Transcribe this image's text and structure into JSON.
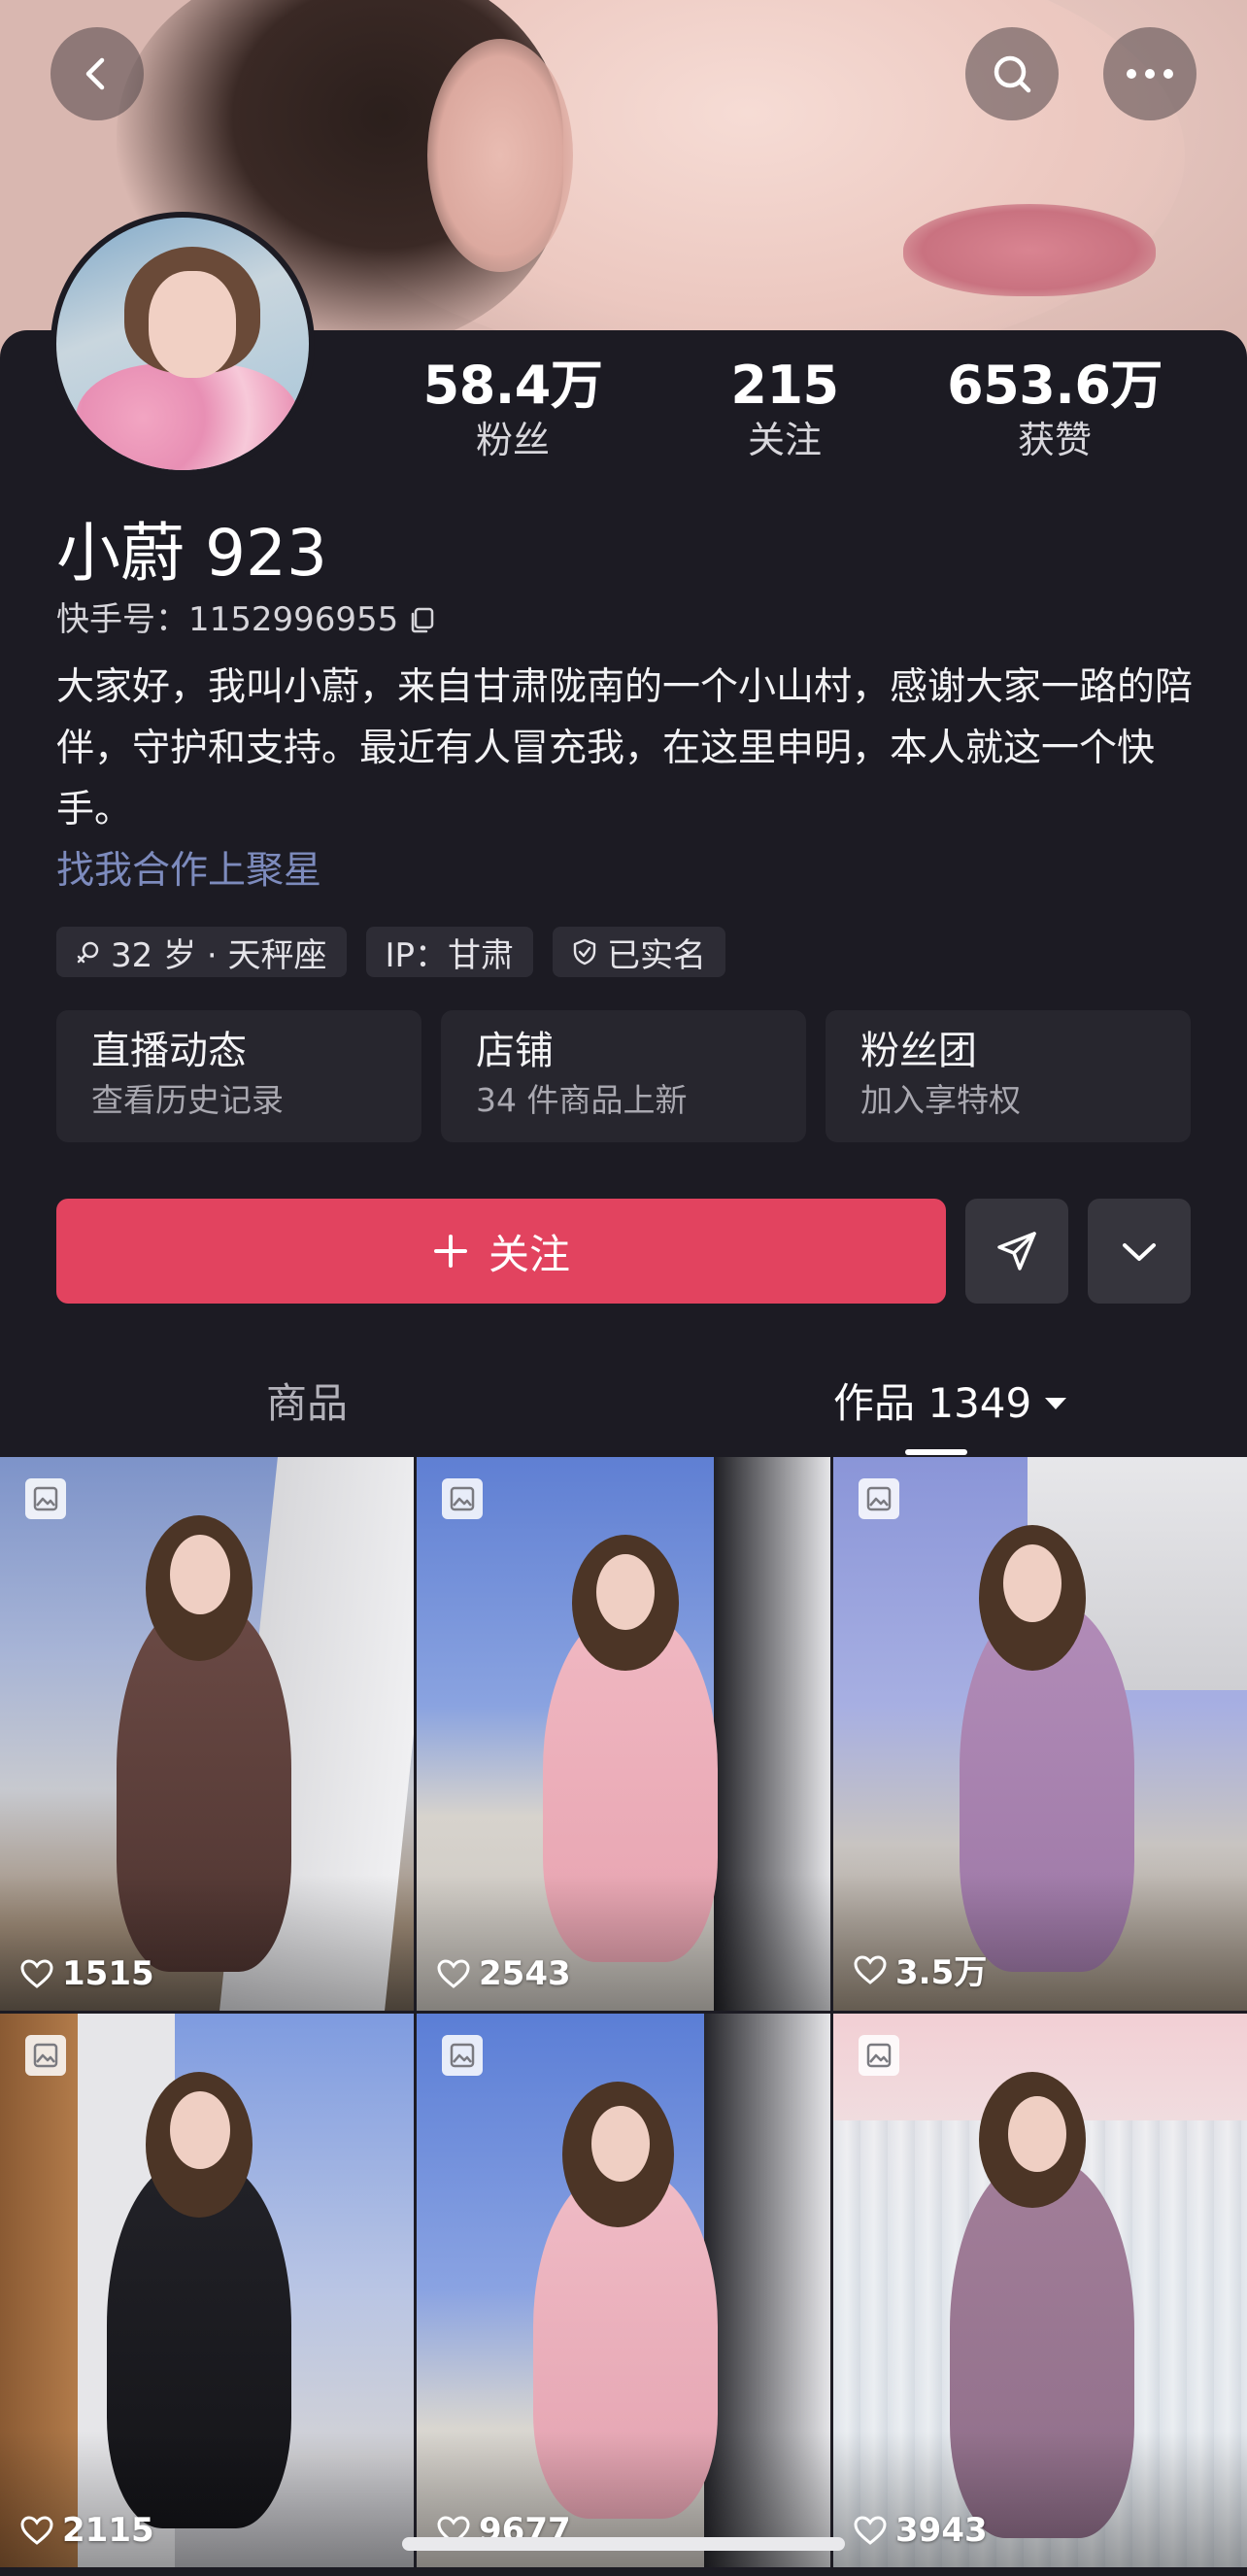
{
  "profile": {
    "name": "小蔚 923",
    "uid_label": "快手号：1152996955",
    "bio": "大家好，我叫小蔚，来自甘肃陇南的一个小山村，感谢大家一路的陪伴，守护和支持。最近有人冒充我，在这里申明，本人就这一个快手。",
    "business_link": "找我合作上聚星"
  },
  "stats": [
    {
      "value": "58.4万",
      "label": "粉丝"
    },
    {
      "value": "215",
      "label": "关注"
    },
    {
      "value": "653.6万",
      "label": "获赞"
    }
  ],
  "tags": [
    {
      "icon": "female-icon",
      "text": "32 岁 · 天秤座"
    },
    {
      "icon": "",
      "text": "IP：甘肃"
    },
    {
      "icon": "shield-check-icon",
      "text": "已实名"
    }
  ],
  "cards": [
    {
      "title": "直播动态",
      "subtitle": "查看历史记录"
    },
    {
      "title": "店铺",
      "subtitle": "34 件商品上新"
    },
    {
      "title": "粉丝团",
      "subtitle": "加入享特权"
    }
  ],
  "actions": {
    "follow_label": "关注"
  },
  "tabs": {
    "goods": "商品",
    "works": "作品 1349"
  },
  "works": [
    {
      "likes": "1515"
    },
    {
      "likes": "2543"
    },
    {
      "likes": "3.5万"
    },
    {
      "likes": "2115"
    },
    {
      "likes": "9677"
    },
    {
      "likes": "3943"
    }
  ],
  "colors": {
    "background": "#1c1b23",
    "accent_follow": "#e2435f",
    "link": "#7d8bbd"
  }
}
